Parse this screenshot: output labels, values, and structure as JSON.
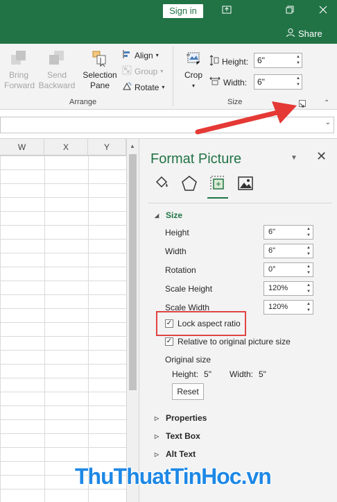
{
  "titlebar": {
    "signin_label": "Sign in",
    "share_label": "Share"
  },
  "ribbon": {
    "bring_forward": [
      "Bring",
      "Forward"
    ],
    "send_backward": [
      "Send",
      "Backward"
    ],
    "selection_pane": [
      "Selection",
      "Pane"
    ],
    "align_label": "Align",
    "group_label": "Group",
    "rotate_label": "Rotate",
    "arrange_group": "Arrange",
    "crop_label": "Crop",
    "height_label": "Height:",
    "height_value": "6\"",
    "width_label": "Width:",
    "width_value": "6\"",
    "size_group": "Size"
  },
  "grid": {
    "columns": [
      "W",
      "X",
      "Y"
    ]
  },
  "pane": {
    "title": "Format Picture",
    "size_section": "Size",
    "height_label": "Height",
    "height_value": "6\"",
    "width_label": "Width",
    "width_value": "6\"",
    "rotation_label": "Rotation",
    "rotation_value": "0°",
    "scale_height_label": "Scale Height",
    "scale_height_value": "120%",
    "scale_width_label": "Scale Width",
    "scale_width_value": "120%",
    "lock_aspect_label": "Lock aspect ratio",
    "relative_label": "Relative to original picture size",
    "original_size_label": "Original size",
    "orig_height_label": "Height:",
    "orig_height_value": "5\"",
    "orig_width_label": "Width:",
    "orig_width_value": "5\"",
    "reset_label": "Reset",
    "properties_section": "Properties",
    "textbox_section": "Text Box",
    "alttext_section": "Alt Text"
  },
  "watermark": "ThuThuatTinHoc.vn",
  "colors": {
    "excel_green": "#217346",
    "highlight_red": "#e04444",
    "arrow_red": "#e53935",
    "watermark_blue": "#1e88e5"
  }
}
